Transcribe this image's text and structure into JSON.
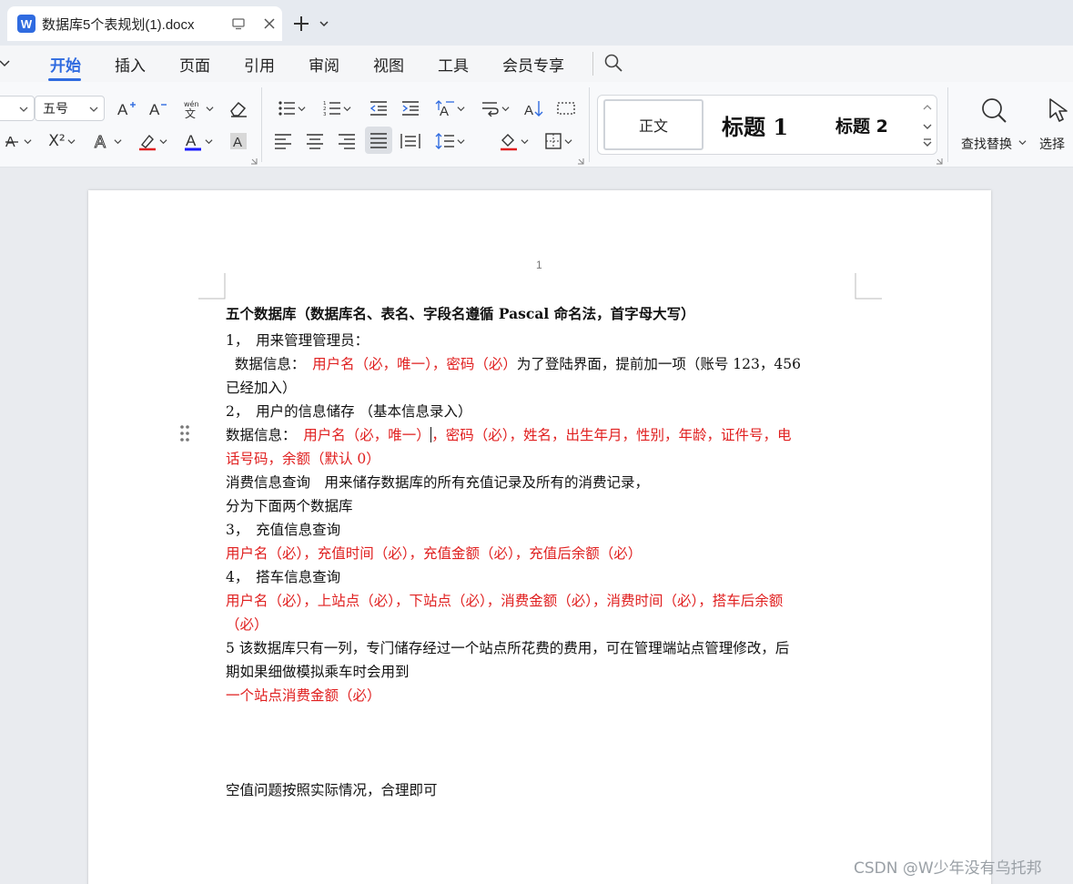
{
  "tab": {
    "doc_badge": "W",
    "title": "数据库5个表规划(1).docx"
  },
  "menu": {
    "items": [
      "开始",
      "插入",
      "页面",
      "引用",
      "审阅",
      "视图",
      "工具",
      "会员专享"
    ]
  },
  "ribbon": {
    "font_size": "五号",
    "font_name": "",
    "superscript": "X²",
    "styles": {
      "normal": "正文",
      "heading1": "标题 1",
      "heading2": "标题 2"
    },
    "find_replace": "查找替换",
    "select": "选择",
    "colors": {
      "accent": "#2f6be0",
      "font_color_bar": "#1a1aff",
      "highlight_bar": "#e02020"
    }
  },
  "document": {
    "page_number": "1",
    "title": "五个数据库（数据库名、表名、字段名遵循 Pascal 命名法，首字母大写）",
    "s1_heading": "1，　用来管理管理员：",
    "s1_data_label": "  数据信息：　",
    "s1_red": "用户名（必，唯一），密码（必）",
    "s1_rest": "为了登陆界面，提前加一项（账号 123，456",
    "s1_rest_cont": "已经加入）",
    "s2_heading": "2，　用户的信息储存 （基本信息录入）",
    "s2_data_label": "数据信息：　",
    "s2_red_a": "用户名（必，唯一）",
    "s2_red_b": "，密码（必），姓名，出生年月，性别，年龄，证件号，电",
    "s2_red_cont": "话号码，余额（默认 0）",
    "consume_line1": "消费信息查询　用来储存数据库的所有充值记录及所有的消费记录，",
    "consume_line2": "分为下面两个数据库",
    "s3_heading": "3，　充值信息查询",
    "s3_red": "用户名（必），充值时间（必），充值金额（必），充值后余额（必）",
    "s4_heading": "4，　搭车信息查询",
    "s4_red": "用户名（必），上站点（必），下站点（必），消费金额（必），消费时间（必），搭车后余额",
    "s4_red_cont": "（必）",
    "s5_line1": "5 该数据库只有一列，专门储存经过一个站点所花费的费用，可在管理端站点管理修改，后",
    "s5_line2": "期如果细做模拟乘车时会用到",
    "s5_red": "一个站点消费金额（必）",
    "null_note": "空值问题按照实际情况，合理即可",
    "text_color_red": "#e02020"
  },
  "watermark": "CSDN @W少年没有乌托邦"
}
